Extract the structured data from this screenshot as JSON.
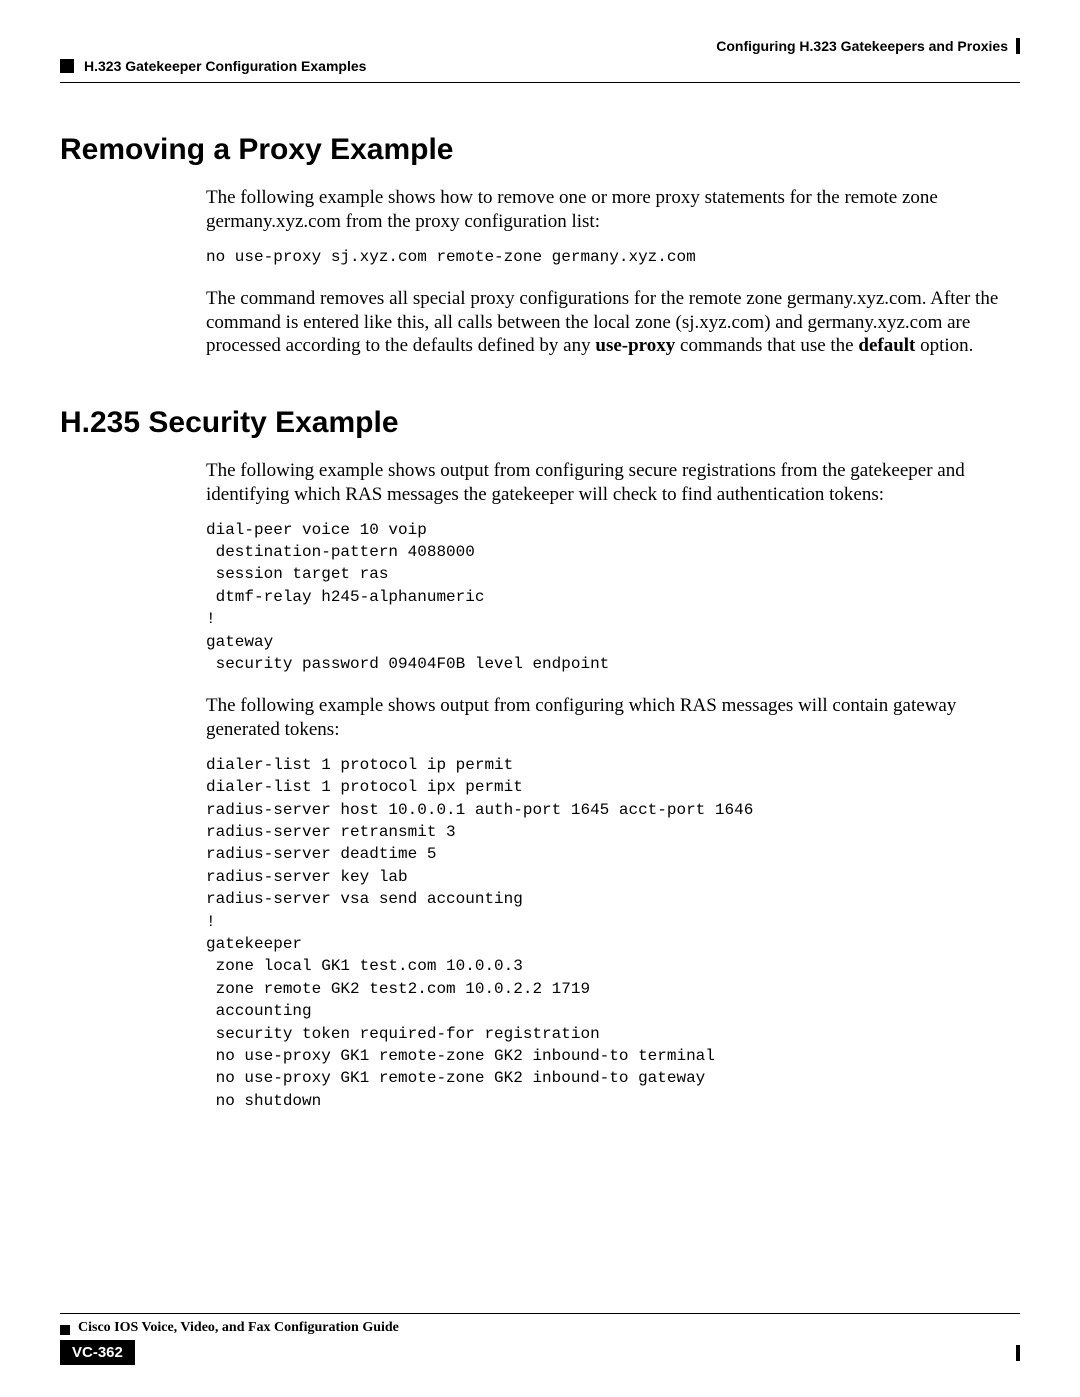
{
  "header": {
    "right": "Configuring H.323 Gatekeepers and Proxies",
    "left": "H.323 Gatekeeper Configuration Examples"
  },
  "section1": {
    "heading": "Removing a Proxy Example",
    "p1": "The following example shows how to remove one or more proxy statements for the remote zone germany.xyz.com from the proxy configuration list:",
    "code1": "no use-proxy sj.xyz.com remote-zone germany.xyz.com",
    "p2a": "The command removes all special proxy configurations for the remote zone germany.xyz.com. After the command is entered like this, all calls between the local zone (sj.xyz.com) and germany.xyz.com are processed according to the defaults defined by any ",
    "p2b": "use-proxy",
    "p2c": " commands that use the ",
    "p2d": "default",
    "p2e": " option."
  },
  "section2": {
    "heading": "H.235 Security Example",
    "p1": "The following example shows output from configuring secure registrations from the gatekeeper and identifying which RAS messages the gatekeeper will check to find authentication tokens:",
    "code1": "dial-peer voice 10 voip\n destination-pattern 4088000\n session target ras\n dtmf-relay h245-alphanumeric\n!\ngateway\n security password 09404F0B level endpoint",
    "p2": "The following example shows output from configuring which RAS messages will contain gateway generated tokens:",
    "code2": "dialer-list 1 protocol ip permit\ndialer-list 1 protocol ipx permit\nradius-server host 10.0.0.1 auth-port 1645 acct-port 1646\nradius-server retransmit 3\nradius-server deadtime 5\nradius-server key lab\nradius-server vsa send accounting\n!\ngatekeeper\n zone local GK1 test.com 10.0.0.3\n zone remote GK2 test2.com 10.0.2.2 1719\n accounting\n security token required-for registration\n no use-proxy GK1 remote-zone GK2 inbound-to terminal\n no use-proxy GK1 remote-zone GK2 inbound-to gateway\n no shutdown"
  },
  "footer": {
    "guide": "Cisco IOS Voice, Video, and Fax Configuration Guide",
    "page": "VC-362"
  }
}
